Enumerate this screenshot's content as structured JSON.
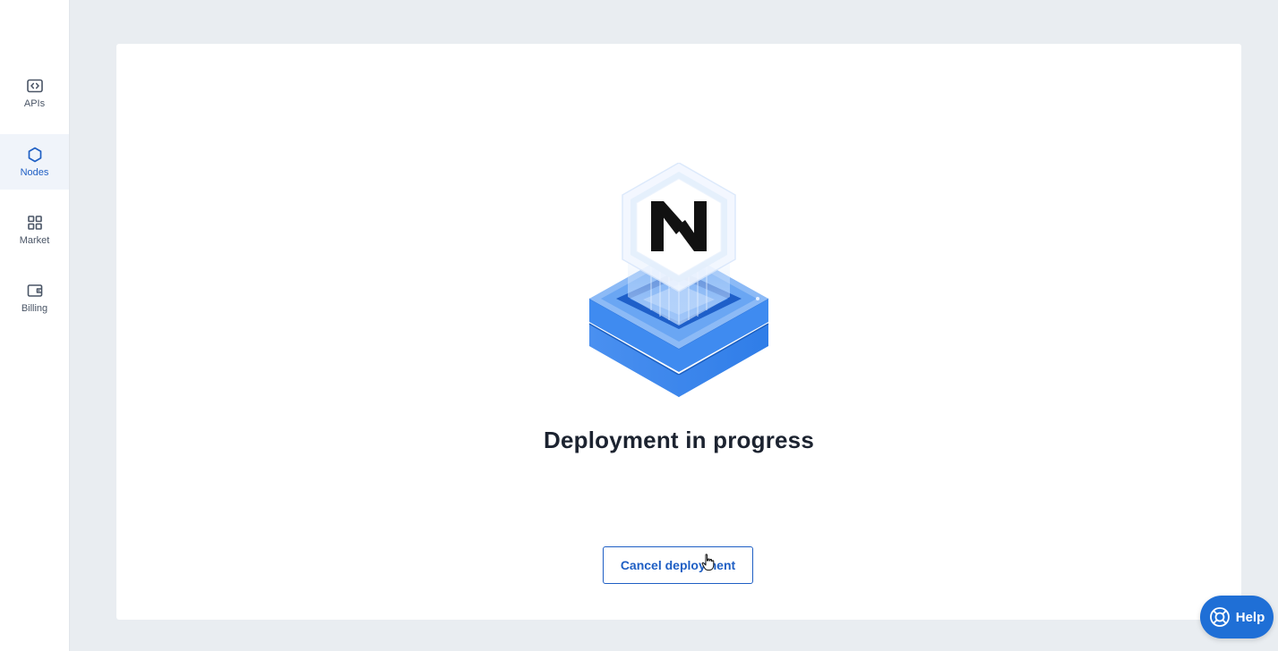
{
  "sidebar": {
    "items": [
      {
        "label": "APIs",
        "icon": "code-window-icon",
        "active": false
      },
      {
        "label": "Nodes",
        "icon": "hexagon-icon",
        "active": true
      },
      {
        "label": "Market",
        "icon": "grid-icon",
        "active": false
      },
      {
        "label": "Billing",
        "icon": "wallet-icon",
        "active": false
      }
    ]
  },
  "main": {
    "illustration": "node-deployment-illustration",
    "logo_icon": "n-logo-icon",
    "title": "Deployment in progress",
    "cancel_label": "Cancel deployment"
  },
  "help": {
    "label": "Help",
    "icon": "lifebuoy-icon"
  },
  "colors": {
    "accent": "#1f5fc4",
    "help_bg": "#1f6fd6",
    "page_bg": "#e9edf1",
    "illustration_blue": "#3d87ee"
  }
}
